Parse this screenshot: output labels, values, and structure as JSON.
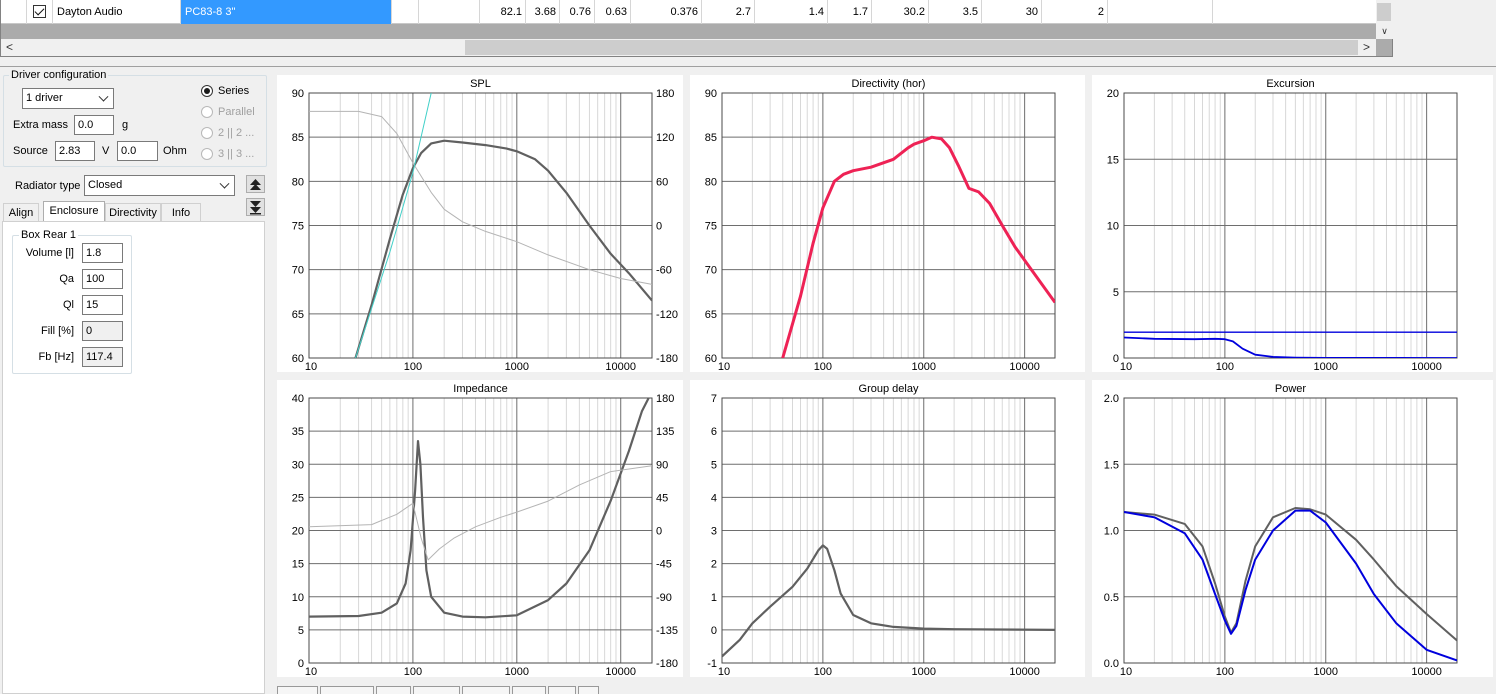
{
  "grid": {
    "row": {
      "checked": true,
      "brand": "Dayton Audio",
      "model": "PC83-8 3\"",
      "values": [
        "82.1",
        "3.68",
        "0.76",
        "0.63",
        "0.376",
        "2.7",
        "1.4",
        "1.7",
        "30.2",
        "3.5",
        "30",
        "2"
      ]
    },
    "scroll_left": "<",
    "scroll_right": ">",
    "scroll_down": "∨"
  },
  "driver_config": {
    "title": "Driver configuration",
    "count": "1 driver",
    "extra_mass_label": "Extra mass",
    "extra_mass": "0.0",
    "extra_mass_unit": "g",
    "source_label": "Source",
    "source_v": "2.83",
    "v_unit": "V",
    "source_ohm": "0.0",
    "ohm_unit": "Ohm",
    "wiring": [
      "Series",
      "Parallel",
      "2 || 2 ...",
      "3 || 3 ..."
    ]
  },
  "radiator": {
    "label": "Radiator type",
    "value": "Closed"
  },
  "tabs": [
    "Align",
    "Enclosure",
    "Directivity",
    "Info"
  ],
  "box": {
    "title": "Box Rear 1",
    "fields": [
      {
        "label": "Volume [l]",
        "value": "1.8"
      },
      {
        "label": "Qa",
        "value": "100"
      },
      {
        "label": "Ql",
        "value": "15"
      },
      {
        "label": "Fill [%]",
        "value": "0"
      },
      {
        "label": "Fb [Hz]",
        "value": "117.4"
      }
    ]
  },
  "colors": {
    "main": "#606060",
    "phase": "#b4b4b4",
    "cone": "#0000dd",
    "directivity": "#ee2255",
    "cursor": "#40d0c8"
  },
  "charts": {
    "x_ticks": [
      "10",
      "100",
      "1000",
      "10000"
    ],
    "spl": {
      "title": "SPL",
      "y": [
        "90",
        "85",
        "80",
        "75",
        "70",
        "65",
        "60"
      ],
      "y2": [
        "180",
        "120",
        "60",
        "0",
        "-60",
        "-120",
        "-180"
      ]
    },
    "directivity": {
      "title": "Directivity (hor)",
      "y": [
        "90",
        "85",
        "80",
        "75",
        "70",
        "65",
        "60"
      ]
    },
    "excursion": {
      "title": "Excursion",
      "y": [
        "20",
        "15",
        "10",
        "5",
        "0"
      ]
    },
    "impedance": {
      "title": "Impedance",
      "y": [
        "40",
        "35",
        "30",
        "25",
        "20",
        "15",
        "10",
        "5",
        "0"
      ],
      "y2": [
        "180",
        "135",
        "90",
        "45",
        "0",
        "-45",
        "-90",
        "-135",
        "-180"
      ]
    },
    "group_delay": {
      "title": "Group delay",
      "y": [
        "7",
        "6",
        "5",
        "4",
        "3",
        "2",
        "1",
        "0",
        "-1"
      ]
    },
    "power": {
      "title": "Power",
      "y": [
        "2.0",
        "1.5",
        "1.0",
        "0.5",
        "0.0"
      ]
    }
  },
  "chart_data": [
    {
      "type": "line",
      "title": "SPL",
      "x_scale": "log",
      "xlim": [
        10,
        20000
      ],
      "ylim": [
        60,
        90
      ],
      "y2lim": [
        -180,
        180
      ],
      "grid": true,
      "series": [
        {
          "values_x": [
            28,
            40,
            60,
            80,
            100,
            120,
            150,
            200,
            300,
            500,
            800,
            1000,
            1500,
            2000,
            3000,
            5000,
            8000,
            12000,
            20000
          ],
          "values_y": [
            60,
            66,
            73.5,
            78.5,
            81.5,
            83.2,
            84.3,
            84.6,
            84.4,
            84.1,
            83.7,
            83.4,
            82.5,
            81.2,
            78.7,
            75.0,
            71.8,
            69.6,
            66.5
          ]
        },
        {
          "axis": "y2",
          "values_x": [
            10,
            30,
            50,
            70,
            100,
            150,
            200,
            300,
            500,
            1000,
            2000,
            5000,
            10000,
            20000
          ],
          "values_y": [
            155,
            155,
            148,
            125,
            85,
            45,
            22,
            5,
            -8,
            -22,
            -40,
            -60,
            -72,
            -80
          ]
        },
        {
          "values_x": [
            28,
            60,
            100,
            150
          ],
          "values_y": [
            60,
            72,
            81,
            90
          ]
        }
      ]
    },
    {
      "type": "line",
      "title": "Directivity (hor)",
      "x_scale": "log",
      "xlim": [
        10,
        20000
      ],
      "ylim": [
        60,
        90
      ],
      "grid": true,
      "series": [
        {
          "values_x": [
            40,
            60,
            80,
            100,
            130,
            160,
            200,
            300,
            500,
            700,
            800,
            1000,
            1200,
            1500,
            1800,
            2200,
            2800,
            3500,
            4500,
            6000,
            8000,
            12000,
            20000
          ],
          "values_y": [
            60,
            67,
            73,
            77,
            80,
            80.8,
            81.2,
            81.6,
            82.5,
            83.8,
            84.2,
            84.6,
            85,
            84.8,
            83.8,
            81.8,
            79.2,
            78.8,
            77.5,
            75.0,
            72.6,
            69.8,
            66.3
          ]
        }
      ]
    },
    {
      "type": "line",
      "title": "Excursion",
      "x_scale": "log",
      "xlim": [
        10,
        20000
      ],
      "ylim": [
        0,
        20
      ],
      "grid": true,
      "series": [
        {
          "values_x": [
            10,
            20000
          ],
          "values_y": [
            1.95,
            1.95
          ]
        },
        {
          "values_x": [
            10,
            20,
            50,
            80,
            100,
            120,
            150,
            200,
            300,
            500,
            1000,
            20000
          ],
          "values_y": [
            1.55,
            1.45,
            1.42,
            1.45,
            1.42,
            1.25,
            0.7,
            0.25,
            0.08,
            0.03,
            0.01,
            0
          ]
        }
      ]
    },
    {
      "type": "line",
      "title": "Impedance",
      "x_scale": "log",
      "xlim": [
        10,
        20000
      ],
      "ylim": [
        0,
        40
      ],
      "y2lim": [
        -180,
        180
      ],
      "grid": true,
      "series": [
        {
          "values_x": [
            10,
            30,
            50,
            70,
            85,
            95,
            105,
            112,
            118,
            125,
            135,
            150,
            200,
            300,
            500,
            1000,
            2000,
            3000,
            5000,
            8000,
            12000,
            16000,
            20000
          ],
          "values_y": [
            7,
            7.1,
            7.6,
            9,
            12,
            17,
            26,
            33.5,
            30,
            22,
            14,
            10,
            7.6,
            7.0,
            6.9,
            7.2,
            9.5,
            12,
            17,
            24.5,
            32,
            38,
            41
          ]
        },
        {
          "axis": "y2",
          "values_x": [
            10,
            40,
            70,
            100,
            120,
            140,
            180,
            250,
            400,
            700,
            1000,
            2000,
            4000,
            8000,
            20000
          ],
          "values_y": [
            5,
            8,
            22,
            37,
            -10,
            -40,
            -25,
            -10,
            5,
            18,
            25,
            40,
            62,
            80,
            88
          ]
        }
      ]
    },
    {
      "type": "line",
      "title": "Group delay",
      "x_scale": "log",
      "xlim": [
        10,
        20000
      ],
      "ylim": [
        -1,
        7
      ],
      "grid": true,
      "series": [
        {
          "values_x": [
            10,
            15,
            20,
            30,
            50,
            70,
            90,
            100,
            110,
            130,
            150,
            200,
            300,
            500,
            1000,
            2000,
            5000,
            20000
          ],
          "values_y": [
            -0.8,
            -0.3,
            0.2,
            0.7,
            1.3,
            1.85,
            2.4,
            2.55,
            2.45,
            1.8,
            1.1,
            0.45,
            0.2,
            0.09,
            0.04,
            0.02,
            0.01,
            0
          ]
        }
      ]
    },
    {
      "type": "line",
      "title": "Power",
      "x_scale": "log",
      "xlim": [
        10,
        20000
      ],
      "ylim": [
        0,
        2
      ],
      "grid": true,
      "series": [
        {
          "values_x": [
            10,
            20,
            40,
            60,
            80,
            100,
            115,
            130,
            160,
            200,
            300,
            500,
            700,
            1000,
            2000,
            3000,
            5000,
            10000,
            20000
          ],
          "values_y": [
            1.14,
            1.12,
            1.05,
            0.88,
            0.6,
            0.35,
            0.23,
            0.3,
            0.62,
            0.88,
            1.1,
            1.17,
            1.16,
            1.12,
            0.93,
            0.78,
            0.58,
            0.37,
            0.17
          ]
        },
        {
          "values_x": [
            10,
            20,
            40,
            60,
            80,
            100,
            115,
            130,
            160,
            200,
            300,
            500,
            700,
            1000,
            2000,
            3000,
            5000,
            10000,
            20000
          ],
          "values_y": [
            1.14,
            1.1,
            0.98,
            0.78,
            0.52,
            0.32,
            0.22,
            0.28,
            0.55,
            0.78,
            1.0,
            1.15,
            1.15,
            1.06,
            0.75,
            0.52,
            0.3,
            0.1,
            0.02
          ]
        }
      ]
    }
  ]
}
